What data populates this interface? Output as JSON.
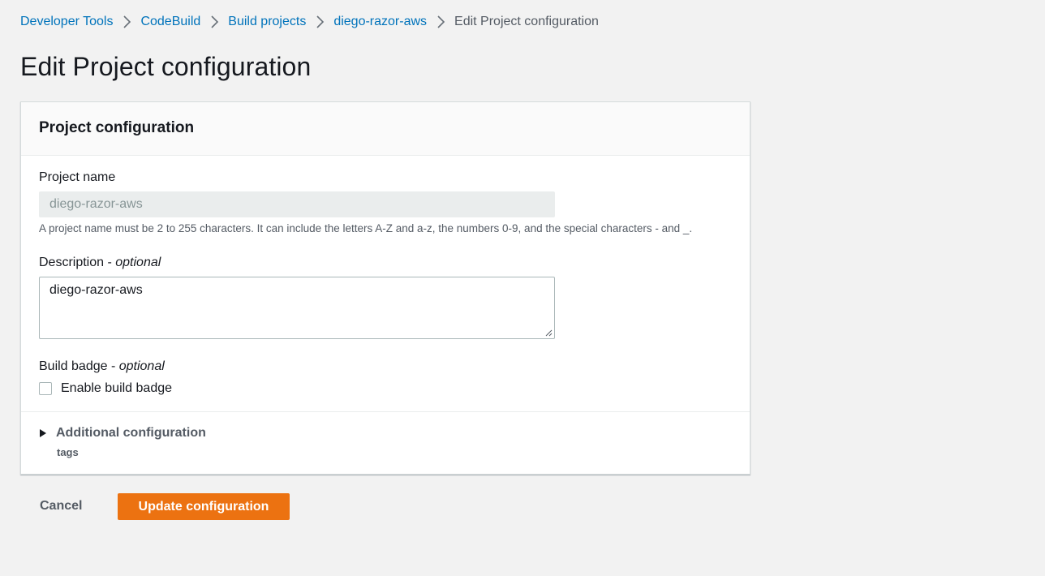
{
  "breadcrumb": {
    "items": [
      "Developer Tools",
      "CodeBuild",
      "Build projects",
      "diego-razor-aws"
    ],
    "current": "Edit Project configuration",
    "separator_icon": "chevron-right-icon"
  },
  "page": {
    "title": "Edit Project configuration"
  },
  "panel": {
    "title": "Project configuration",
    "project_name": {
      "label": "Project name",
      "value": "diego-razor-aws",
      "hint": "A project name must be 2 to 255 characters. It can include the letters A-Z and a-z, the numbers 0-9, and the special characters - and _."
    },
    "description": {
      "label": "Description - ",
      "optional": "optional",
      "value": "diego-razor-aws"
    },
    "build_badge": {
      "label": "Build badge - ",
      "optional": "optional",
      "checkbox_label": "Enable build badge",
      "checked": false
    },
    "additional": {
      "label": "Additional configuration",
      "sub": "tags",
      "icon": "caret-right-icon"
    }
  },
  "actions": {
    "cancel": "Cancel",
    "submit": "Update configuration"
  },
  "colors": {
    "link": "#0073bb",
    "primary": "#ec7211",
    "background": "#f2f2f2"
  }
}
